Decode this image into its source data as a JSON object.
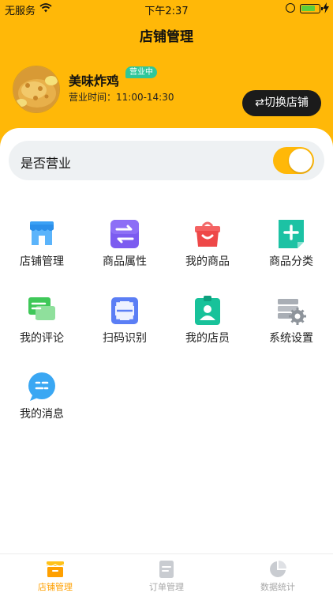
{
  "status_bar": {
    "carrier": "无服务",
    "time": "下午2:37"
  },
  "header": {
    "title": "店铺管理"
  },
  "store": {
    "name": "美味炸鸡",
    "badge": "营业中",
    "hours": "营业时间：11:00-14:30",
    "switch_label": "⇄切换店铺"
  },
  "business_toggle": {
    "label": "是否营业",
    "on": true
  },
  "grid": [
    {
      "label": "店铺管理",
      "icon": "store-icon"
    },
    {
      "label": "商品属性",
      "icon": "transfer-icon"
    },
    {
      "label": "我的商品",
      "icon": "shopping-bag-icon"
    },
    {
      "label": "商品分类",
      "icon": "add-document-icon"
    },
    {
      "label": "我的评论",
      "icon": "comment-icon"
    },
    {
      "label": "扫码识别",
      "icon": "scan-icon"
    },
    {
      "label": "我的店员",
      "icon": "staff-badge-icon"
    },
    {
      "label": "系统设置",
      "icon": "settings-gear-icon"
    },
    {
      "label": "我的消息",
      "icon": "message-bubble-icon"
    }
  ],
  "tabbar": [
    {
      "label": "店铺管理",
      "icon": "store-tab-icon",
      "active": true
    },
    {
      "label": "订单管理",
      "icon": "order-tab-icon",
      "active": false
    },
    {
      "label": "数据统计",
      "icon": "chart-tab-icon",
      "active": false
    }
  ],
  "colors": {
    "accent": "#FFB808",
    "active_tab": "#FFA000",
    "badge": "#2fc79a",
    "dark_button": "#1b1b1b"
  }
}
